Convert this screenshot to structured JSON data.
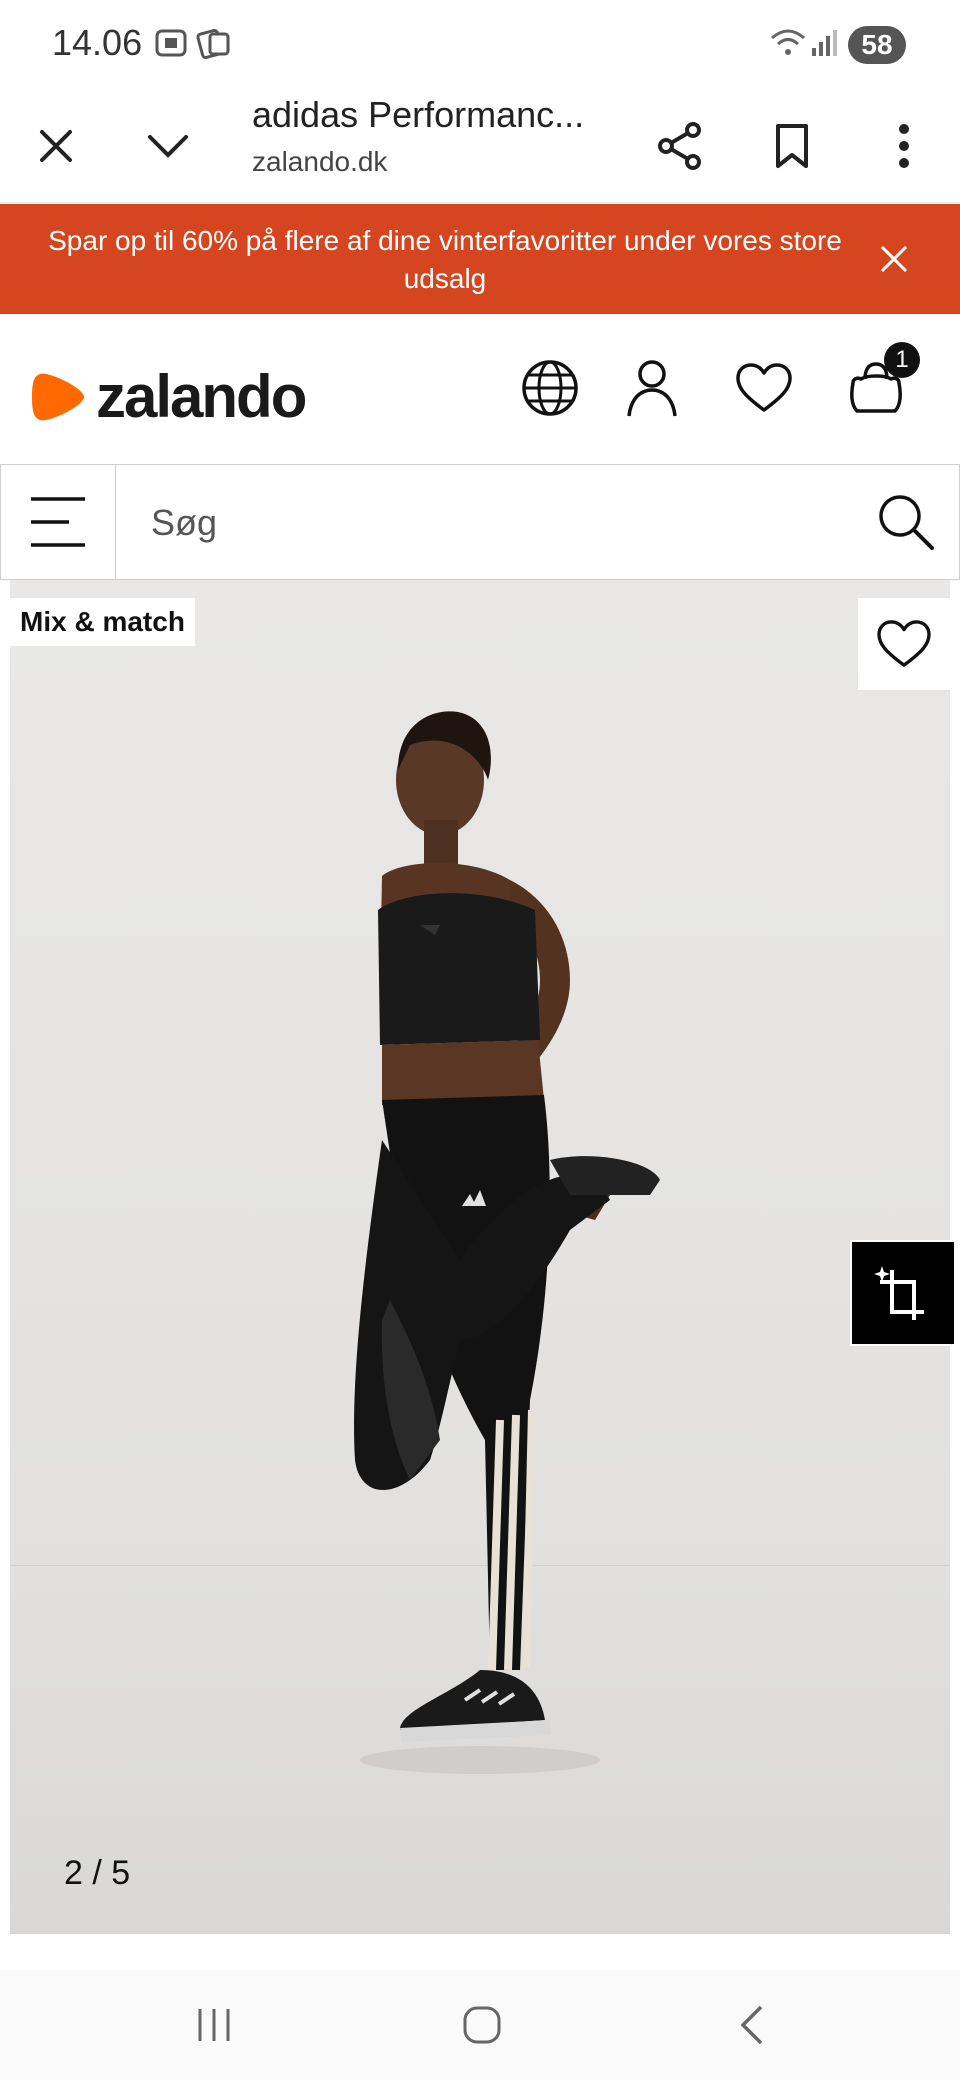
{
  "status_bar": {
    "time": "14.06",
    "battery": "58"
  },
  "browser": {
    "title": "adidas Performanc...",
    "url": "zalando.dk"
  },
  "banner": {
    "text": "Spar op til 60% på flere af dine vinterfavoritter under vores store udsalg"
  },
  "header": {
    "logo_text": "zalando",
    "cart_count": "1"
  },
  "search": {
    "placeholder": "Søg"
  },
  "gallery": {
    "badge": "Mix & match",
    "counter": "2 / 5"
  },
  "colors": {
    "banner_bg": "#d5451f",
    "brand_orange": "#ff6900"
  },
  "icons": [
    "close-icon",
    "chevron-down-icon",
    "share-icon",
    "bookmark-icon",
    "more-vert-icon",
    "globe-icon",
    "user-icon",
    "heart-icon",
    "bag-icon",
    "menu-icon",
    "search-icon",
    "outfit-icon"
  ]
}
